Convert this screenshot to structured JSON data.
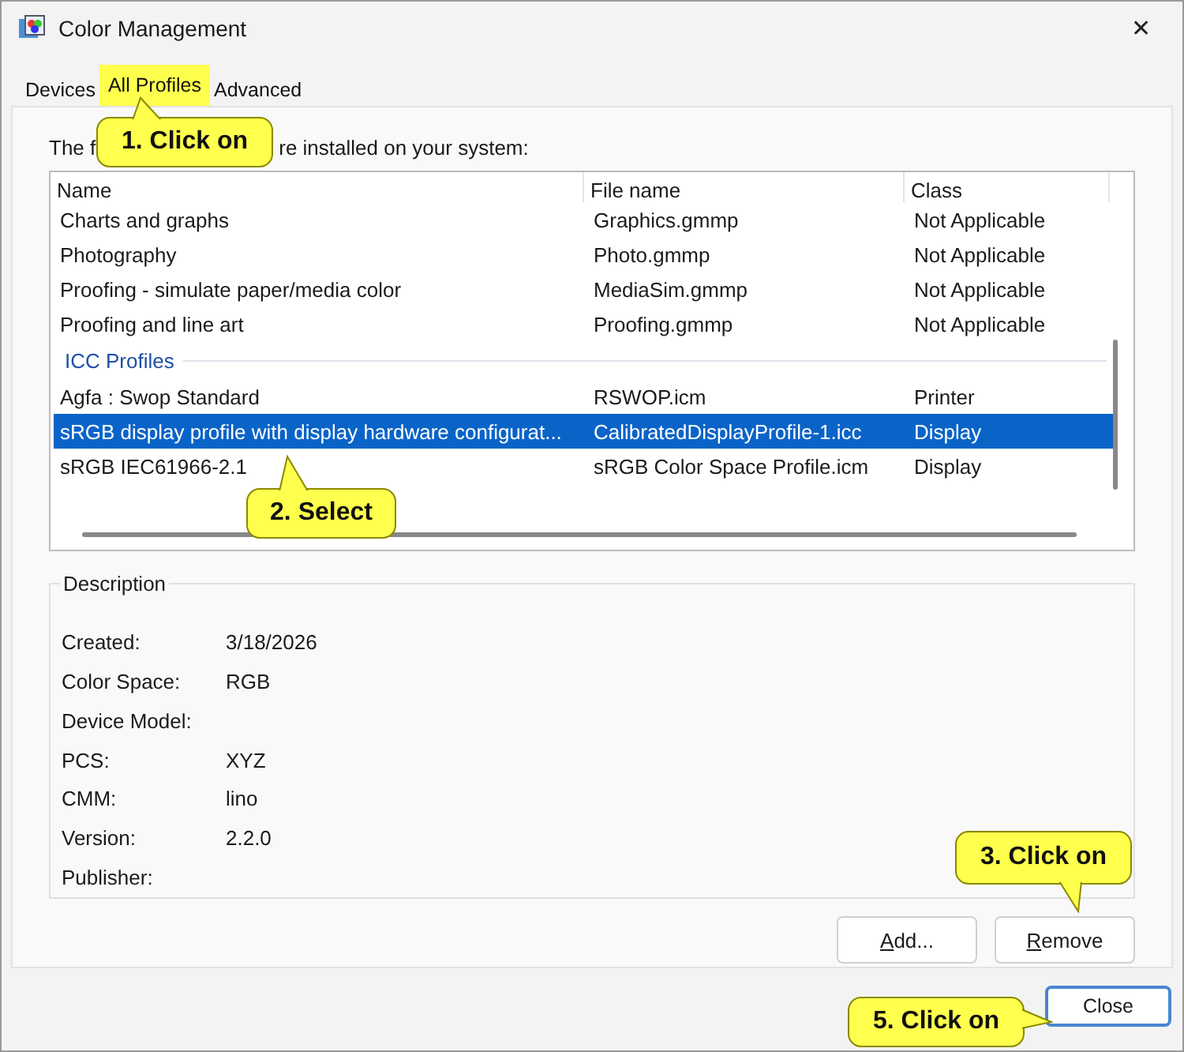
{
  "window": {
    "title": "Color Management",
    "close": "✕"
  },
  "tabs": [
    {
      "label": "Devices",
      "selected": false
    },
    {
      "label": "All Profiles",
      "selected": true
    },
    {
      "label": "Advanced",
      "selected": false
    }
  ],
  "intro": {
    "before": "The f",
    "after": "re installed on your system:"
  },
  "table": {
    "columns": [
      "Name",
      "File name",
      "Class"
    ],
    "rows": [
      {
        "kind": "row",
        "cells": [
          "Charts and graphs",
          "Graphics.gmmp",
          "Not Applicable"
        ],
        "selected": false
      },
      {
        "kind": "row",
        "cells": [
          "Photography",
          "Photo.gmmp",
          "Not Applicable"
        ],
        "selected": false
      },
      {
        "kind": "row",
        "cells": [
          "Proofing - simulate paper/media color",
          "MediaSim.gmmp",
          "Not Applicable"
        ],
        "selected": false
      },
      {
        "kind": "row",
        "cells": [
          "Proofing and line art",
          "Proofing.gmmp",
          "Not Applicable"
        ],
        "selected": false
      },
      {
        "kind": "group",
        "label": "ICC Profiles"
      },
      {
        "kind": "row",
        "cells": [
          "Agfa : Swop Standard",
          "RSWOP.icm",
          "Printer"
        ],
        "selected": false
      },
      {
        "kind": "row",
        "cells": [
          "sRGB display profile with display hardware configurat...",
          "CalibratedDisplayProfile-1.icc",
          "Display"
        ],
        "selected": true
      },
      {
        "kind": "row",
        "cells": [
          "sRGB IEC61966-2.1",
          "sRGB Color Space Profile.icm",
          "Display"
        ],
        "selected": false
      }
    ]
  },
  "description": {
    "title": "Description",
    "fields": [
      {
        "label": "Created:",
        "value": "3/18/2026"
      },
      {
        "label": "Color Space:",
        "value": "RGB"
      },
      {
        "label": "Device Model:"
      },
      {
        "label": "PCS:",
        "value": "XYZ"
      },
      {
        "label": "CMM:",
        "value": "lino"
      },
      {
        "label": "Version:",
        "value": "2.2.0"
      },
      {
        "label": "Publisher:"
      }
    ]
  },
  "buttons": [
    {
      "label": "Add..."
    },
    {
      "label": "Remove"
    }
  ],
  "close_button": "Close",
  "callouts": [
    {
      "text": "1. Click on",
      "kind": "up"
    },
    {
      "text": "2. Select",
      "kind": "up"
    },
    {
      "text": "3. Click on",
      "kind": "down"
    },
    {
      "text": "5. Click on",
      "kind": "right"
    }
  ]
}
